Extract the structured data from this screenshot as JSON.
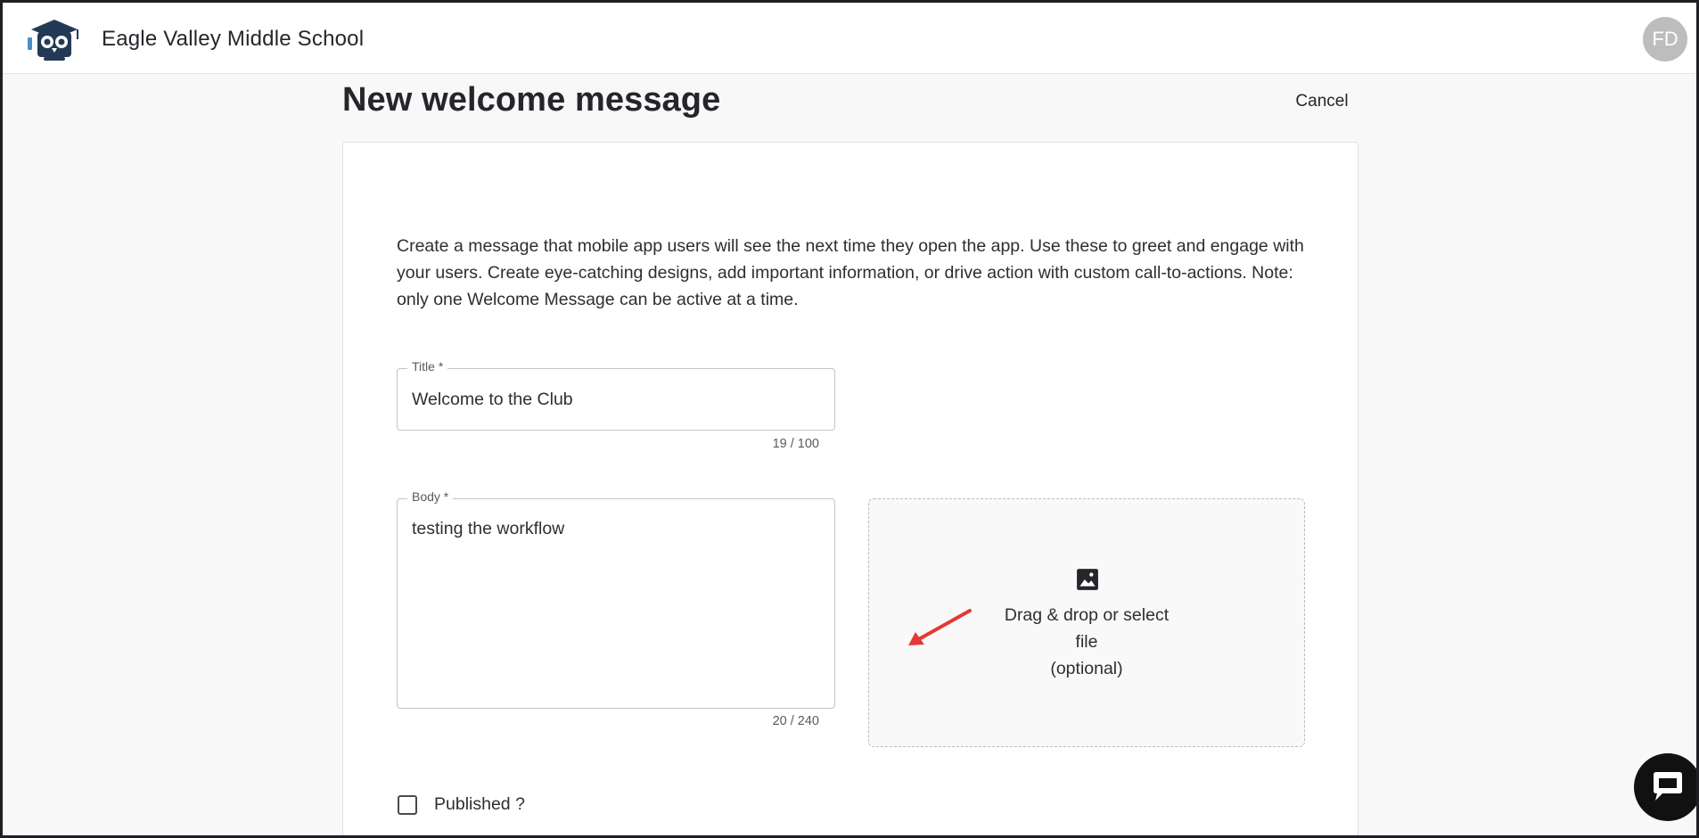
{
  "header": {
    "school_name": "Eagle Valley Middle School",
    "user_initials": "FD"
  },
  "page": {
    "title": "New welcome message",
    "cancel_label": "Cancel"
  },
  "form": {
    "intro_text": "Create a message that mobile app users will see the next time they open the app. Use these to greet and engage with your users. Create eye-catching designs, add important information, or drive action with custom call-to-actions. Note: only one Welcome Message can be active at a time.",
    "title_field": {
      "label": "Title *",
      "value": "Welcome to the Club",
      "counter": "19 / 100"
    },
    "body_field": {
      "label": "Body *",
      "value": "testing the workflow",
      "counter": "20 / 240"
    },
    "dropzone": {
      "line1": "Drag & drop or select",
      "line2": "file",
      "line3": "(optional)",
      "icon": "image-icon"
    },
    "published_label": "Published ?",
    "published_checked": false
  },
  "colors": {
    "text_primary": "#25252b",
    "annotation_arrow": "#e53935",
    "logo_navy": "#233a56",
    "chat_button": "#111111"
  }
}
